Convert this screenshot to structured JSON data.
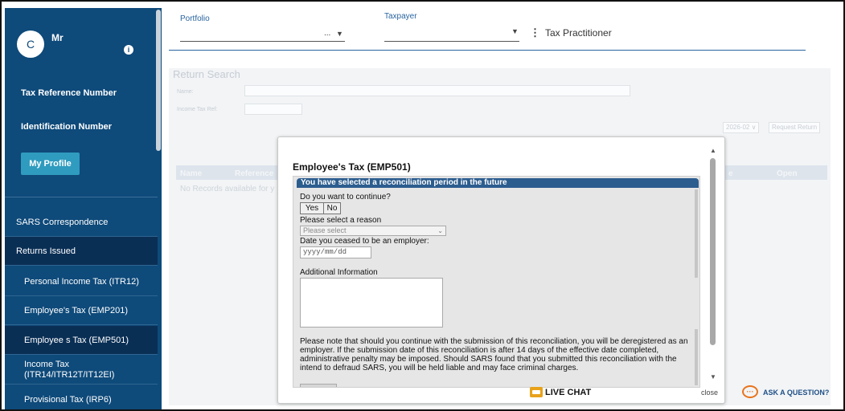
{
  "sidebar": {
    "avatar_initial": "C",
    "user_name": "Mr",
    "info_icon": "info-icon",
    "tax_reference_label": "Tax Reference Number",
    "identification_label": "Identification Number",
    "profile_button": "My Profile",
    "nav": [
      {
        "label": "SARS Correspondence"
      },
      {
        "label": "Returns Issued"
      },
      {
        "label": "Personal Income Tax (ITR12)"
      },
      {
        "label": "Employee's Tax (EMP201)"
      },
      {
        "label": "Employee s Tax (EMP501)"
      },
      {
        "label": "Income Tax (ITR14/ITR12T/IT12EI)"
      },
      {
        "label": "Provisional Tax (IRP6)"
      }
    ]
  },
  "header": {
    "portfolio_label": "Portfolio",
    "portfolio_value": "...",
    "taxpayer_label": "Taxpayer",
    "practitioner": "Tax Practitioner"
  },
  "background": {
    "title": "Return Search",
    "name_label": "Name:",
    "income_tax_ref_label": "Income Tax Ref:",
    "period_select": "2026-02 ∨",
    "request_return": "Request Return",
    "columns": [
      "Name",
      "Reference",
      "e",
      "Open"
    ],
    "no_records": "No Records available for y"
  },
  "modal": {
    "title": "Employee's Tax (EMP501)",
    "banner": "You have selected a reconciliation period in the future",
    "continue_question": "Do you want to continue?",
    "yes": "Yes",
    "no": "No",
    "reason_label": "Please select a reason",
    "reason_placeholder": "Please select",
    "ceased_label": "Date you ceased to be an employer:",
    "date_placeholder": "yyyy/mm/dd",
    "additional_label": "Additional Information",
    "note": "Please note that should you continue with the submission of this reconciliation, you will be deregistered as an employer. If the submission date of this reconciliation is after 14 days of the effective date completed, administrative penalty may be imposed. Should SARS found that you submitted this reconciliation with the intend to defraud SARS, you will be held liable and may face criminal charges.",
    "live_chat": "LIVE CHAT",
    "close": "close"
  },
  "ask": {
    "label": "ASK A QUESTION?"
  },
  "colors": {
    "sidebar_bg": "#0e4a7a",
    "sidebar_dark": "#0a2f55",
    "accent": "#2f9bbf",
    "banner": "#2c5d8f",
    "ask_orange": "#e8731a"
  }
}
